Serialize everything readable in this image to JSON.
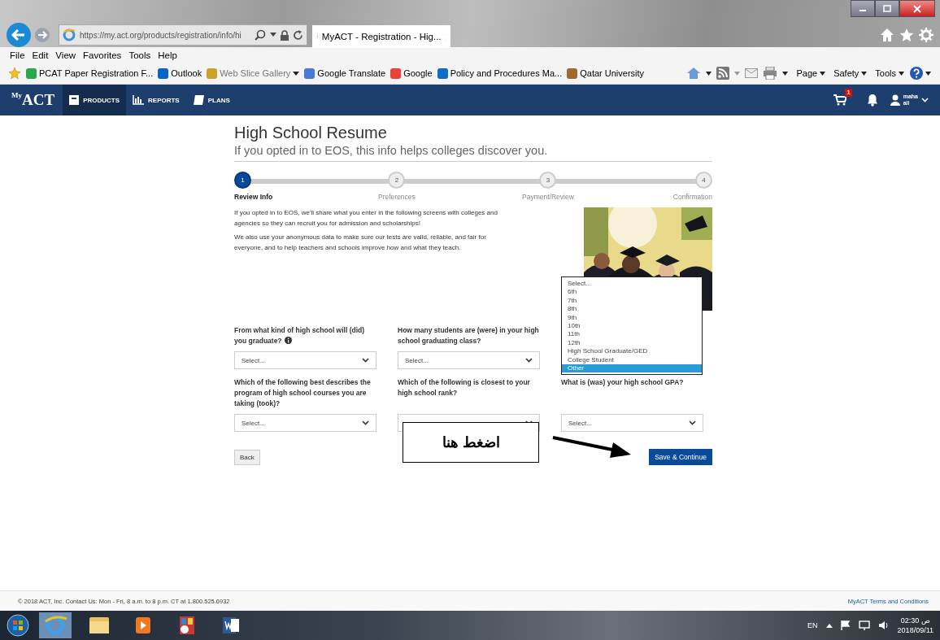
{
  "browser": {
    "address": "https://my.act.org/products/registration/info/hi",
    "tab_title": "MyACT - Registration - Hig...",
    "menu": [
      "File",
      "Edit",
      "View",
      "Favorites",
      "Tools",
      "Help"
    ],
    "favorites": [
      {
        "label": "PCAT Paper Registration F...",
        "disabled": false,
        "dropdown": false
      },
      {
        "label": "Outlook",
        "disabled": false,
        "dropdown": false
      },
      {
        "label": "Web Slice Gallery",
        "disabled": true,
        "dropdown": true
      },
      {
        "label": "Google Translate",
        "disabled": false,
        "dropdown": false
      },
      {
        "label": "Google",
        "disabled": false,
        "dropdown": false
      },
      {
        "label": "Policy and Procedures Ma...",
        "disabled": false,
        "dropdown": false
      },
      {
        "label": "Qatar University",
        "disabled": false,
        "dropdown": false
      }
    ],
    "commands": [
      "Page",
      "Safety",
      "Tools"
    ]
  },
  "site_nav": {
    "logo_prefix": "My",
    "logo": "ACT",
    "items": [
      {
        "label": "PRODUCTS",
        "selected": true
      },
      {
        "label": "REPORTS",
        "selected": false
      },
      {
        "label": "PLANS",
        "selected": false
      }
    ],
    "cart_badge": "1",
    "user_first": "maha",
    "user_last": "ali"
  },
  "page": {
    "title": "High School Resume",
    "subtitle": "If you opted in to EOS, this info helps colleges discover you.",
    "steps": [
      {
        "number": "1",
        "label": "Review Info",
        "selected": true
      },
      {
        "number": "2",
        "label": "Preferences",
        "selected": false
      },
      {
        "number": "3",
        "label": "Payment/Review",
        "selected": false
      },
      {
        "number": "4",
        "label": "Confirmation",
        "selected": false
      }
    ],
    "paragraphs": [
      "If you opted in to EOS, we'll share what you enter in the following screens with colleges and agencies so they can recruit you for admission and scholarships!",
      "We also use your anonymous data to make sure our tests are valid, reliable, and fair for everyone, and to help teachers and schools improve how and what they teach."
    ],
    "fields": [
      {
        "kind": "select",
        "label": "From what kind of high school will (did) you graduate?",
        "info": true,
        "value": "Select..."
      },
      {
        "kind": "select",
        "label": "How many students are (were) in your high school graduating class?",
        "info": false,
        "value": "Select..."
      },
      {
        "kind": "open-list",
        "options": [
          {
            "label": "Select...",
            "selected": false
          },
          {
            "label": "6th",
            "selected": false
          },
          {
            "label": "7th",
            "selected": false
          },
          {
            "label": "8th",
            "selected": false
          },
          {
            "label": "9th",
            "selected": false
          },
          {
            "label": "10th",
            "selected": false
          },
          {
            "label": "11th",
            "selected": false
          },
          {
            "label": "12th",
            "selected": false
          },
          {
            "label": "High School Graduate/GED",
            "selected": false
          },
          {
            "label": "College Student",
            "selected": false
          },
          {
            "label": "Other",
            "selected": true
          }
        ]
      },
      {
        "kind": "select",
        "label": "Which of the following best describes the program of high school courses you are taking (took)?",
        "info": false,
        "value": "Select..."
      },
      {
        "kind": "select",
        "label": "Which of the following is closest to your high school rank?",
        "info": false
      },
      {
        "kind": "select",
        "label": "What is (was) your high school GPA?",
        "info": false,
        "value": "Select..."
      }
    ],
    "back": "Back",
    "save": "Save & Continue",
    "annotation": "اضغط هنا"
  },
  "footer": {
    "text": "© 2018 ACT, Inc. Contact Us: Mon - Fri, 8 a.m. to 8 p.m. CT at 1.800.525.6932",
    "link": "MyACT Terms and Conditions"
  },
  "taskbar": {
    "language": "EN",
    "time": "02:30 ص",
    "date": "2018/09/11"
  }
}
